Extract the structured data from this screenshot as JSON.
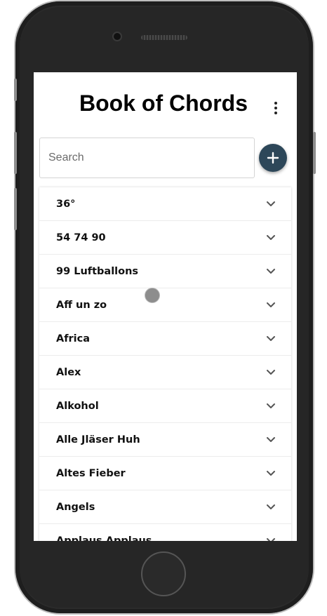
{
  "header": {
    "title": "Book of Chords"
  },
  "search": {
    "placeholder": "Search",
    "value": ""
  },
  "songs": [
    "36°",
    "54 74 90",
    "99 Luftballons",
    "Aff un zo",
    "Africa",
    "Alex",
    "Alkohol",
    "Alle Jläser Huh",
    "Altes Fieber",
    "Angels",
    "Applaus Applaus"
  ],
  "colors": {
    "accent": "#2d4759",
    "frame": "#2b2b2b"
  },
  "icons": {
    "menu": "more-vert-icon",
    "add": "plus-icon",
    "expand": "chevron-down-icon"
  }
}
